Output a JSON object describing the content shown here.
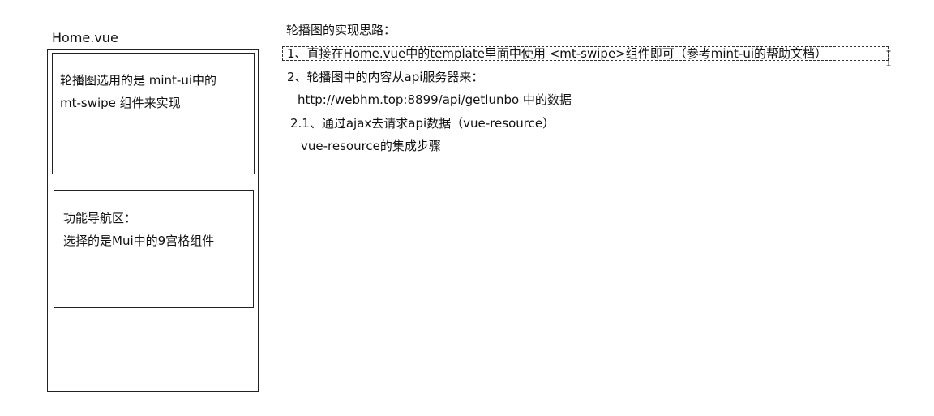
{
  "left_panel": {
    "file_label": "Home.vue",
    "swipe_box": {
      "line1": "轮播图选用的是 mint-ui中的",
      "line2": "mt-swipe 组件来实现"
    },
    "nav_box": {
      "line1": "功能导航区：",
      "line2": "选择的是Mui中的9宫格组件"
    }
  },
  "notes": {
    "title": "轮播图的实现思路：",
    "step1": "1、直接在Home.vue中的template里面中使用 <mt-swipe>组件即可（参考mint-ui的帮助文档）",
    "step2": "2、轮播图中的内容从api服务器来：",
    "api_url": "http://webhm.top:8899/api/getlunbo 中的数据",
    "step2_1": "2.1、通过ajax去请求api数据（vue-resource）",
    "vue_resource": "vue-resource的集成步骤"
  },
  "icons": {
    "cursor": "text-cursor-icon"
  }
}
